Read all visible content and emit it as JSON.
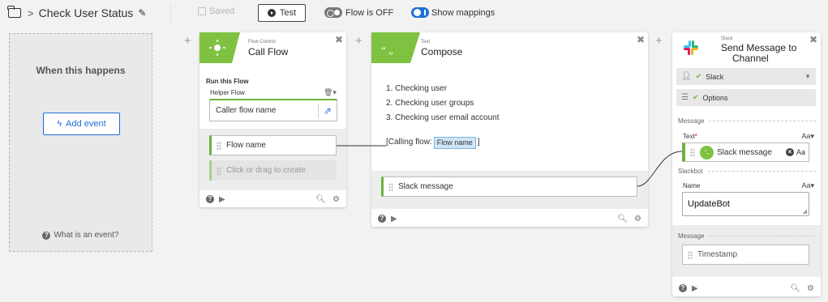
{
  "topbar": {
    "flow_title": "Check User Status",
    "saved_label": "Saved",
    "test_label": "Test",
    "flow_state_label": "Flow is OFF",
    "mappings_label": "Show mappings"
  },
  "trigger": {
    "heading": "When this happens",
    "add_event_label": "Add event",
    "help_label": "What is an event?"
  },
  "call_flow": {
    "subtitle": "Flow Control",
    "title": "Call Flow",
    "section": "Run this Flow",
    "helper_label": "Helper Flow",
    "caller_value": "Caller flow name",
    "flow_name_field": "Flow name",
    "create_placeholder": "Click or drag to create"
  },
  "compose": {
    "subtitle": "Text",
    "title": "Compose",
    "lines": [
      "1. Checking user",
      "2. Checking user groups",
      "3. Checking user email account"
    ],
    "calling_prefix": "[Calling flow:",
    "calling_pill": "Flow name",
    "calling_suffix": "]",
    "output_field": "Slack message"
  },
  "slack": {
    "subtitle": "Slack",
    "title_line1": "Send Message to",
    "title_line2": "Channel",
    "connection": "Slack",
    "options": "Options",
    "message_section": "Message",
    "text_label": "Text",
    "required_mark": "*",
    "text_format": "Aa",
    "slack_message_pill": "Slack message",
    "pill_format": "Aa",
    "slackbot_section": "Slackbot",
    "name_label": "Name",
    "name_format": "Aa",
    "name_value": "UpdateBot",
    "message_section2": "Message",
    "timestamp_field": "Timestamp"
  },
  "colors": {
    "accent_blue": "#1e6fd9",
    "flow_green": "#6cb33f",
    "compose_green": "#7fc241"
  }
}
